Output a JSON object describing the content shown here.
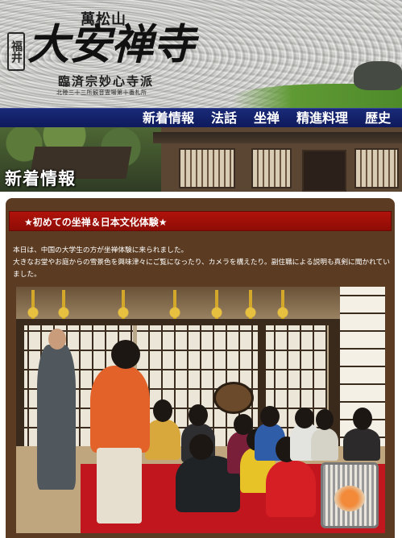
{
  "header": {
    "mountain_name": "萬松山",
    "prefecture": "福井",
    "temple_name": "大安禅寺",
    "sect": "臨済宗妙心寺派",
    "pilgrimage_note": "北陸三十三所観音霊場第十番札所"
  },
  "nav": {
    "items": [
      {
        "label": "新着情報"
      },
      {
        "label": "法話"
      },
      {
        "label": "坐禅"
      },
      {
        "label": "精進料理"
      },
      {
        "label": "歴史"
      }
    ]
  },
  "banner": {
    "title": "新着情報"
  },
  "article": {
    "title": "★初めての坐禅＆日本文化体験★",
    "paragraph_1": "本日は、中国の大学生の方が坐禅体験に来られました。",
    "paragraph_2": "大きなお堂やお庭からの雪景色を興味津々にご覧になったり、カメラを構えたり。副住職による説明も真剣に聞かれていました。"
  },
  "colors": {
    "nav_background": "#0e1a5c",
    "panel_background": "#5b3c22",
    "article_header": "#a3100a"
  }
}
